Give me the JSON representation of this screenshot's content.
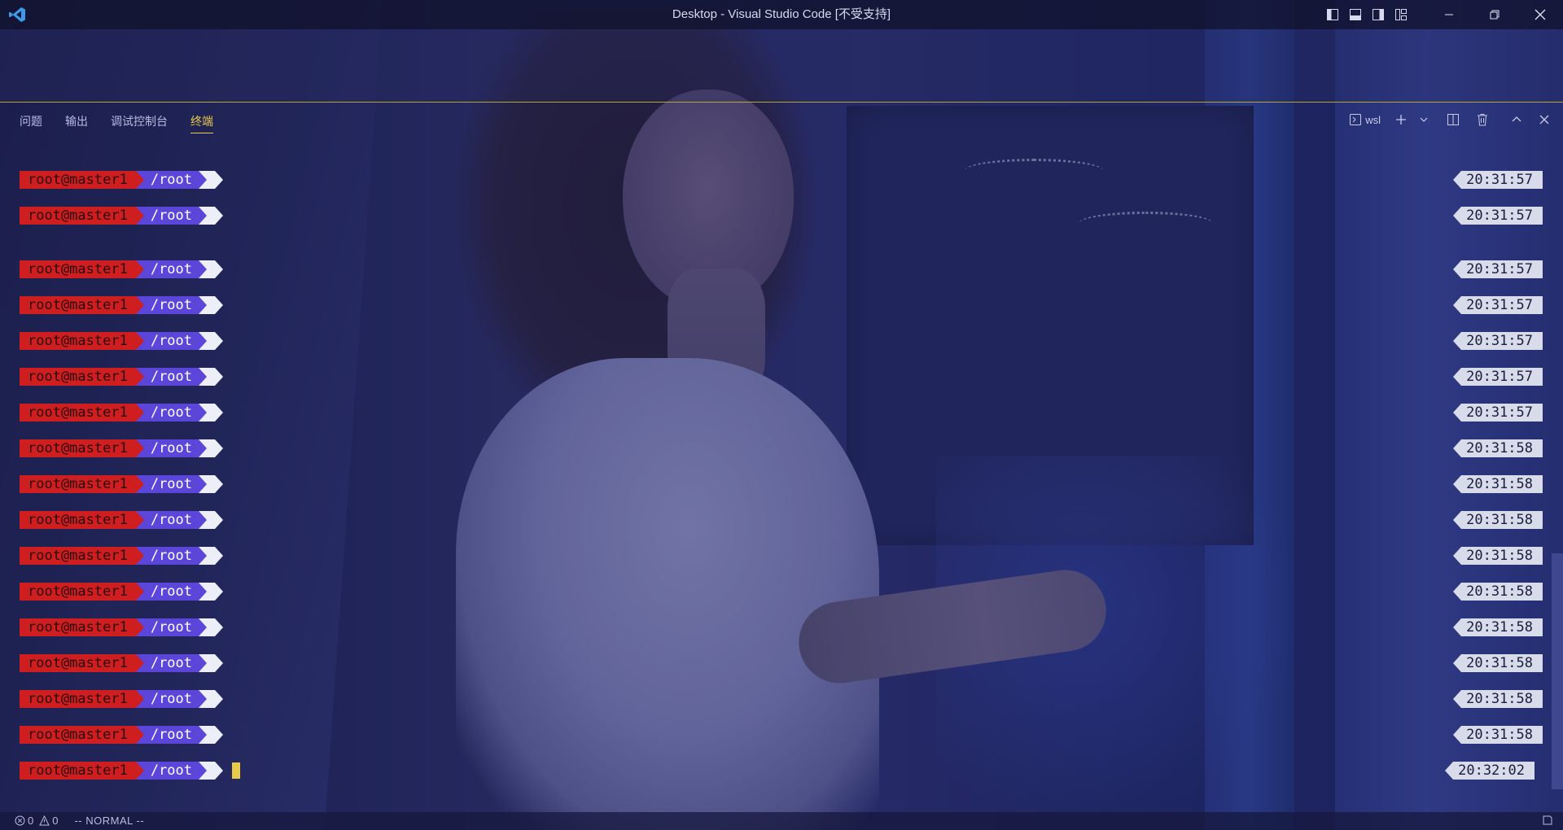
{
  "window": {
    "title": "Desktop - Visual Studio Code [不受支持]"
  },
  "panel": {
    "tabs": [
      {
        "label": "问题",
        "active": false
      },
      {
        "label": "输出",
        "active": false
      },
      {
        "label": "调试控制台",
        "active": false
      },
      {
        "label": "终端",
        "active": true
      }
    ],
    "shell_label": "wsl"
  },
  "terminal": {
    "user": "root@master1",
    "path": "/root",
    "lines": [
      {
        "time": "20:31:57"
      },
      {
        "time": "20:31:57"
      },
      {
        "time": "20:31:57"
      },
      {
        "time": "20:31:57"
      },
      {
        "time": "20:31:57"
      },
      {
        "time": "20:31:57"
      },
      {
        "time": "20:31:57"
      },
      {
        "time": "20:31:58"
      },
      {
        "time": "20:31:58"
      },
      {
        "time": "20:31:58"
      },
      {
        "time": "20:31:58"
      },
      {
        "time": "20:31:58"
      },
      {
        "time": "20:31:58"
      },
      {
        "time": "20:31:58"
      },
      {
        "time": "20:31:58"
      },
      {
        "time": "20:31:58"
      },
      {
        "time": "20:32:02"
      }
    ]
  },
  "statusbar": {
    "errors": "0",
    "warnings": "0",
    "mode": "-- NORMAL --"
  },
  "colors": {
    "accent": "#e9c948",
    "user_segment": "#cf1e1f",
    "path_segment": "#5c45d9",
    "time_segment": "#d8dbe9"
  }
}
